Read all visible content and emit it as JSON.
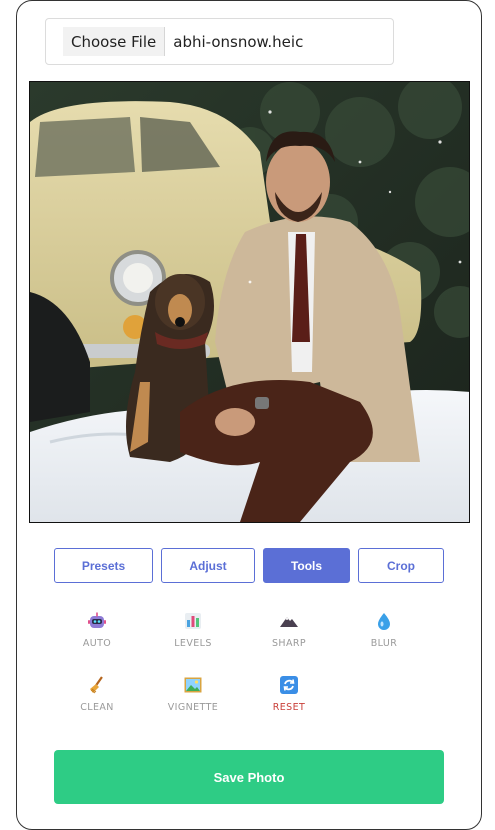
{
  "file_input": {
    "button_label": "Choose File",
    "file_name": "abhi-onsnow.heic"
  },
  "tabs": [
    {
      "label": "Presets",
      "active": false
    },
    {
      "label": "Adjust",
      "active": false
    },
    {
      "label": "Tools",
      "active": true
    },
    {
      "label": "Crop",
      "active": false
    }
  ],
  "tools": [
    {
      "label": "AUTO",
      "icon": "robot-icon"
    },
    {
      "label": "LEVELS",
      "icon": "bar-chart-icon"
    },
    {
      "label": "SHARP",
      "icon": "mountain-icon"
    },
    {
      "label": "BLUR",
      "icon": "droplet-icon"
    },
    {
      "label": "CLEAN",
      "icon": "broom-icon"
    },
    {
      "label": "VIGNETTE",
      "icon": "picture-icon"
    },
    {
      "label": "RESET",
      "icon": "refresh-icon"
    }
  ],
  "save_label": "Save Photo",
  "colors": {
    "accent": "#5b6fd6",
    "save": "#2ecc85",
    "reset": "#c9403a"
  }
}
